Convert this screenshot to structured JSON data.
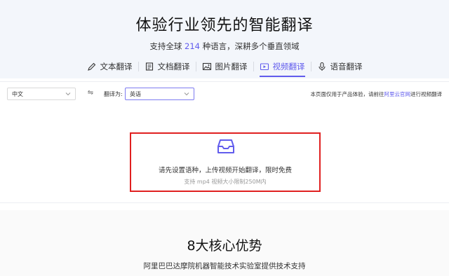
{
  "hero": {
    "title": "体验行业领先的智能翻译",
    "subtitle_prefix": "支持全球",
    "subtitle_number": "214",
    "subtitle_suffix": "种语言，深耕多个垂直领域"
  },
  "tabs": [
    {
      "label": "文本翻译",
      "icon": "pen-icon",
      "active": false
    },
    {
      "label": "文档翻译",
      "icon": "document-icon",
      "active": false
    },
    {
      "label": "图片翻译",
      "icon": "image-icon",
      "active": false
    },
    {
      "label": "视频翻译",
      "icon": "video-icon",
      "active": true
    },
    {
      "label": "语音翻译",
      "icon": "microphone-icon",
      "active": false
    }
  ],
  "toolbar": {
    "source_language": "中文",
    "swap_icon": "swap-icon",
    "target_label": "翻译为:",
    "target_language": "英语",
    "notice_prefix": "本页面仅用于产品体验，请前往",
    "notice_link": "阿里云官网",
    "notice_suffix": "进行视频翻译"
  },
  "upload": {
    "icon": "inbox-icon",
    "main_text": "请先设置语种，上传视频开始翻译，限时免费",
    "hint_text": "支持 mp4 视频大小限制250M内"
  },
  "advantages": {
    "title": "8大核心优势",
    "subtitle": "阿里巴巴达摩院机器智能技术实验室提供技术支持"
  },
  "colors": {
    "accent": "#615ced",
    "highlight_border": "#e02020",
    "hero_background": "#f3f6fb"
  }
}
